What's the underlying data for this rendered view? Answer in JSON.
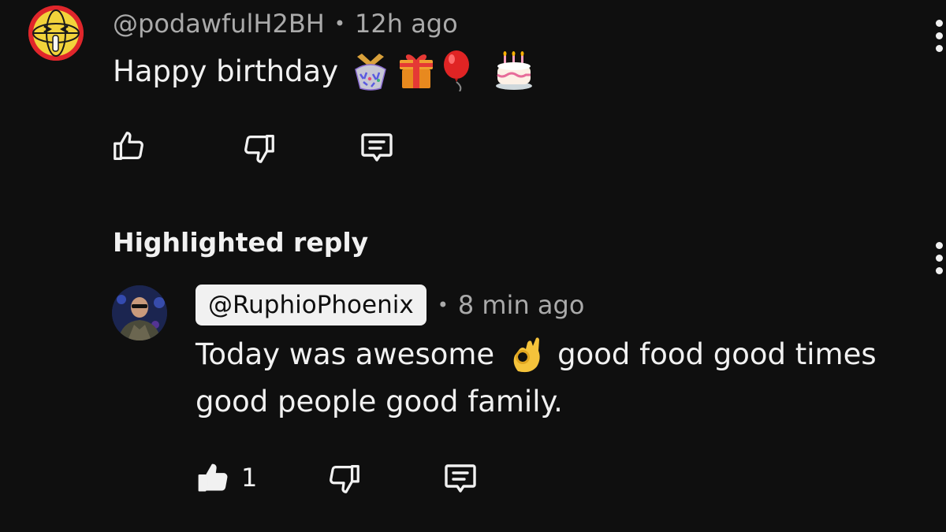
{
  "comment": {
    "author": "@podawfulH2BH",
    "separator": "•",
    "time": "12h ago",
    "text": "Happy birthday",
    "emoji": [
      "confetti-ball",
      "wrapped-gift",
      "balloon",
      "birthday-cake"
    ]
  },
  "highlight": {
    "label": "Highlighted reply"
  },
  "reply": {
    "author": "@RuphioPhoenix",
    "separator": "•",
    "time": "8 min ago",
    "text_line1_before": "Today was awesome",
    "text_line1_after": "good food good times",
    "text_line2": "good people good family.",
    "emoji": [
      "ok-hand"
    ],
    "like_count": "1",
    "liked": true
  },
  "icons": {
    "like": "thumbs-up-icon",
    "dislike": "thumbs-down-icon",
    "reply": "comment-icon",
    "more": "more-vertical-icon"
  },
  "colors": {
    "background": "#0f0f0f",
    "text_primary": "#f1f1f1",
    "text_secondary": "#aaaaaa",
    "avatar_ring": "#e0262b",
    "avatar_face": "#f2d33b"
  }
}
